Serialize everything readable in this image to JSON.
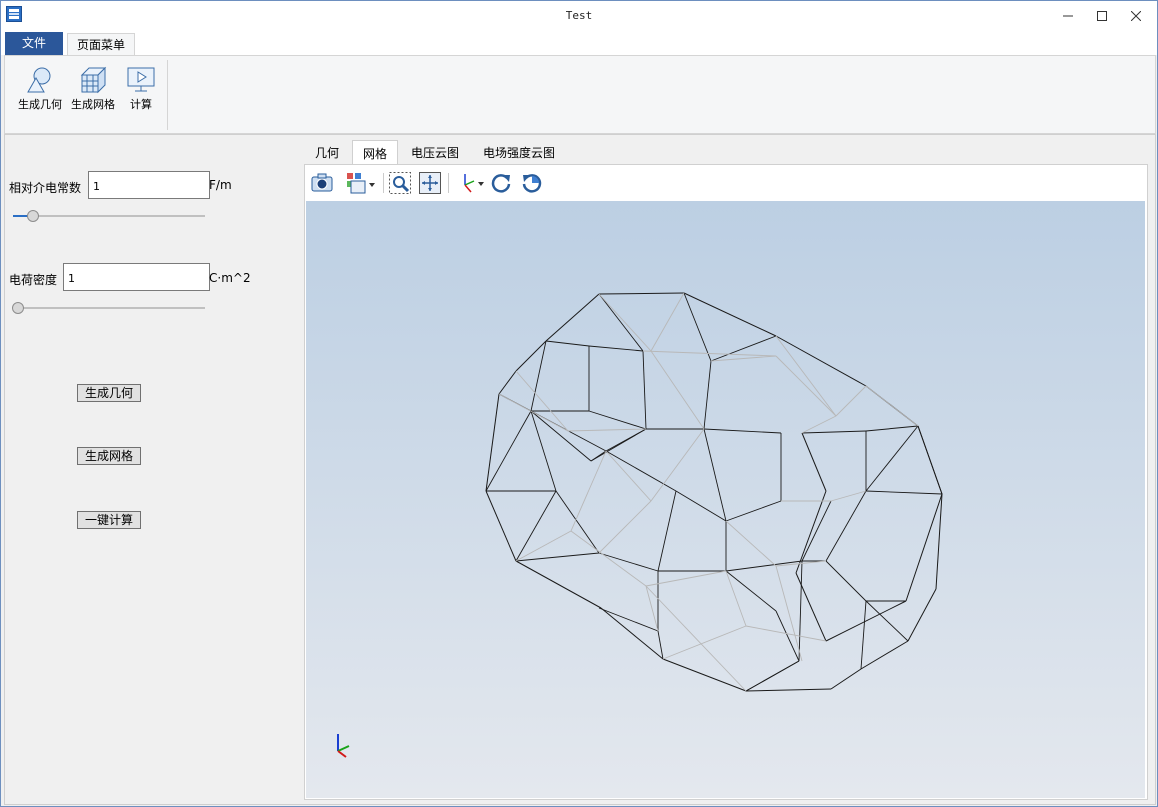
{
  "window": {
    "title": "Test"
  },
  "menu": {
    "file_label": "文件",
    "page_menu_label": "页面菜单"
  },
  "ribbon": {
    "buttons": [
      {
        "label": "生成几何",
        "icon": "geometry-icon"
      },
      {
        "label": "生成网格",
        "icon": "mesh-icon"
      },
      {
        "label": "计算",
        "icon": "compute-icon"
      }
    ]
  },
  "params": {
    "permittivity": {
      "label": "相对介电常数",
      "value": "1",
      "unit": "F/m",
      "slider_fraction": 0.1
    },
    "charge_density": {
      "label": "电荷密度",
      "value": "1",
      "unit": "C·m^2",
      "slider_fraction": 0.0
    }
  },
  "actions": {
    "geometry_label": "生成几何",
    "mesh_label": "生成网格",
    "compute_label": "一键计算"
  },
  "viewer": {
    "tabs": [
      {
        "label": "几何",
        "active": false
      },
      {
        "label": "网格",
        "active": true
      },
      {
        "label": "电压云图",
        "active": false
      },
      {
        "label": "电场强度云图",
        "active": false
      }
    ],
    "toolbar_icons": [
      "camera-icon",
      "view-mode-icon",
      "zoom-box-icon",
      "fit-view-icon",
      "axes-orientation-icon",
      "rotate-cw-icon",
      "rotate-ccw-icon"
    ],
    "axis_triad": {
      "x_color": "#d11a1a",
      "y_color": "#19a319",
      "z_color": "#1a3fd1"
    }
  },
  "colors": {
    "accent": "#2b579a",
    "mesh_dark": "#1a1a1a",
    "mesh_light": "#b8b8b8"
  }
}
